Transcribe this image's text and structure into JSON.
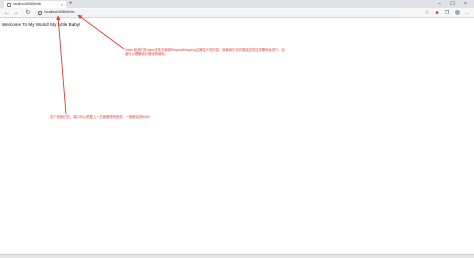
{
  "tab": {
    "title": "localhost:8080/hello",
    "close": "×"
  },
  "new_tab": "+",
  "window_controls": {
    "minimize": "–",
    "maximize": "☐",
    "close": "×"
  },
  "toolbar": {
    "back_icon": "←",
    "forward_icon": "→",
    "refresh_icon": "↻",
    "url": "localhost:8080/hello",
    "favorite_icon": "☆",
    "collections_icon": "❒",
    "menu_icon": "…"
  },
  "page": {
    "text": "Welcome To My World! My Little Baby!"
  },
  "annotations": {
    "first": "/hello 就我们在class文件中使用RequestMapping注解定义的内容，就像我们访问路径这些应用需地址进行，后者可以理解设计路径网使用。",
    "second": "这个是我们的，端口可以根据上一方面要修改西说，一般都会改8080"
  },
  "colors": {
    "annotation": "#e53935",
    "tabstrip": "#dfe3e8",
    "toolbar": "#f7f7f7"
  }
}
